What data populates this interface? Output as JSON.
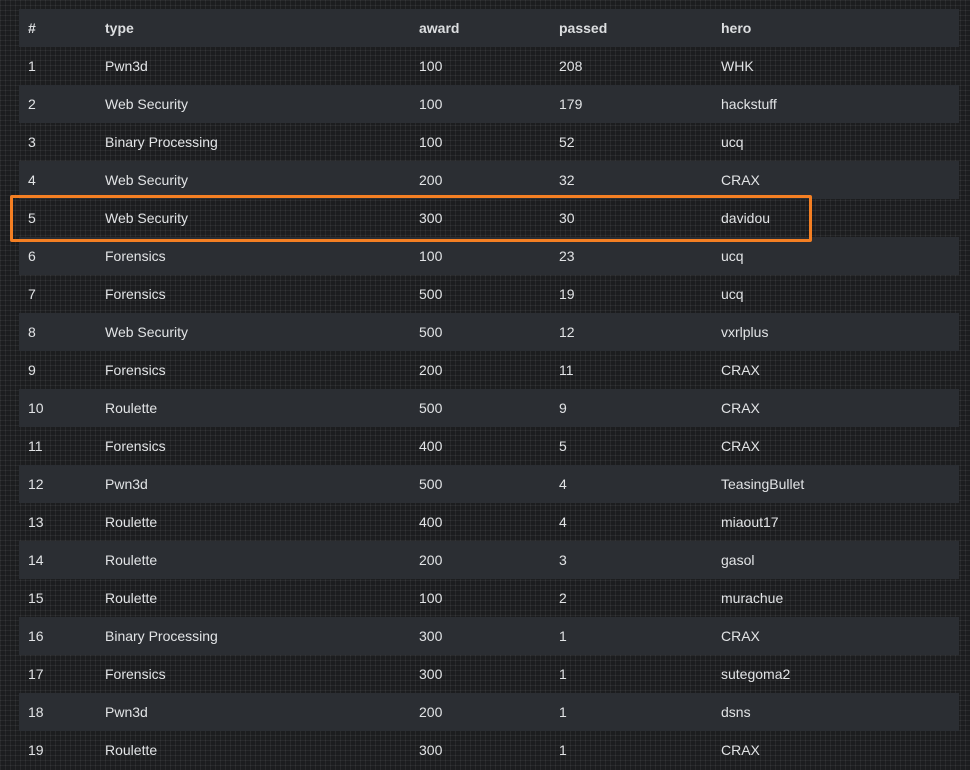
{
  "table": {
    "headers": [
      "#",
      "type",
      "award",
      "passed",
      "hero"
    ],
    "rows": [
      [
        "1",
        "Pwn3d",
        "100",
        "208",
        "WHK"
      ],
      [
        "2",
        "Web Security",
        "100",
        "179",
        "hackstuff"
      ],
      [
        "3",
        "Binary Processing",
        "100",
        "52",
        "ucq"
      ],
      [
        "4",
        "Web Security",
        "200",
        "32",
        "CRAX"
      ],
      [
        "5",
        "Web Security",
        "300",
        "30",
        "davidou"
      ],
      [
        "6",
        "Forensics",
        "100",
        "23",
        "ucq"
      ],
      [
        "7",
        "Forensics",
        "500",
        "19",
        "ucq"
      ],
      [
        "8",
        "Web Security",
        "500",
        "12",
        "vxrlplus"
      ],
      [
        "9",
        "Forensics",
        "200",
        "11",
        "CRAX"
      ],
      [
        "10",
        "Roulette",
        "500",
        "9",
        "CRAX"
      ],
      [
        "11",
        "Forensics",
        "400",
        "5",
        "CRAX"
      ],
      [
        "12",
        "Pwn3d",
        "500",
        "4",
        "TeasingBullet"
      ],
      [
        "13",
        "Roulette",
        "400",
        "4",
        "miaout17"
      ],
      [
        "14",
        "Roulette",
        "200",
        "3",
        "gasol"
      ],
      [
        "15",
        "Roulette",
        "100",
        "2",
        "murachue"
      ],
      [
        "16",
        "Binary Processing",
        "300",
        "1",
        "CRAX"
      ],
      [
        "17",
        "Forensics",
        "300",
        "1",
        "sutegoma2"
      ],
      [
        "18",
        "Pwn3d",
        "200",
        "1",
        "dsns"
      ],
      [
        "19",
        "Roulette",
        "300",
        "1",
        "CRAX"
      ]
    ],
    "highlighted_row": "5"
  },
  "colors": {
    "background": "#1c1d1f",
    "stripe": "#2b2e33",
    "text": "#e2e4e6",
    "highlight": "#f47f23"
  }
}
